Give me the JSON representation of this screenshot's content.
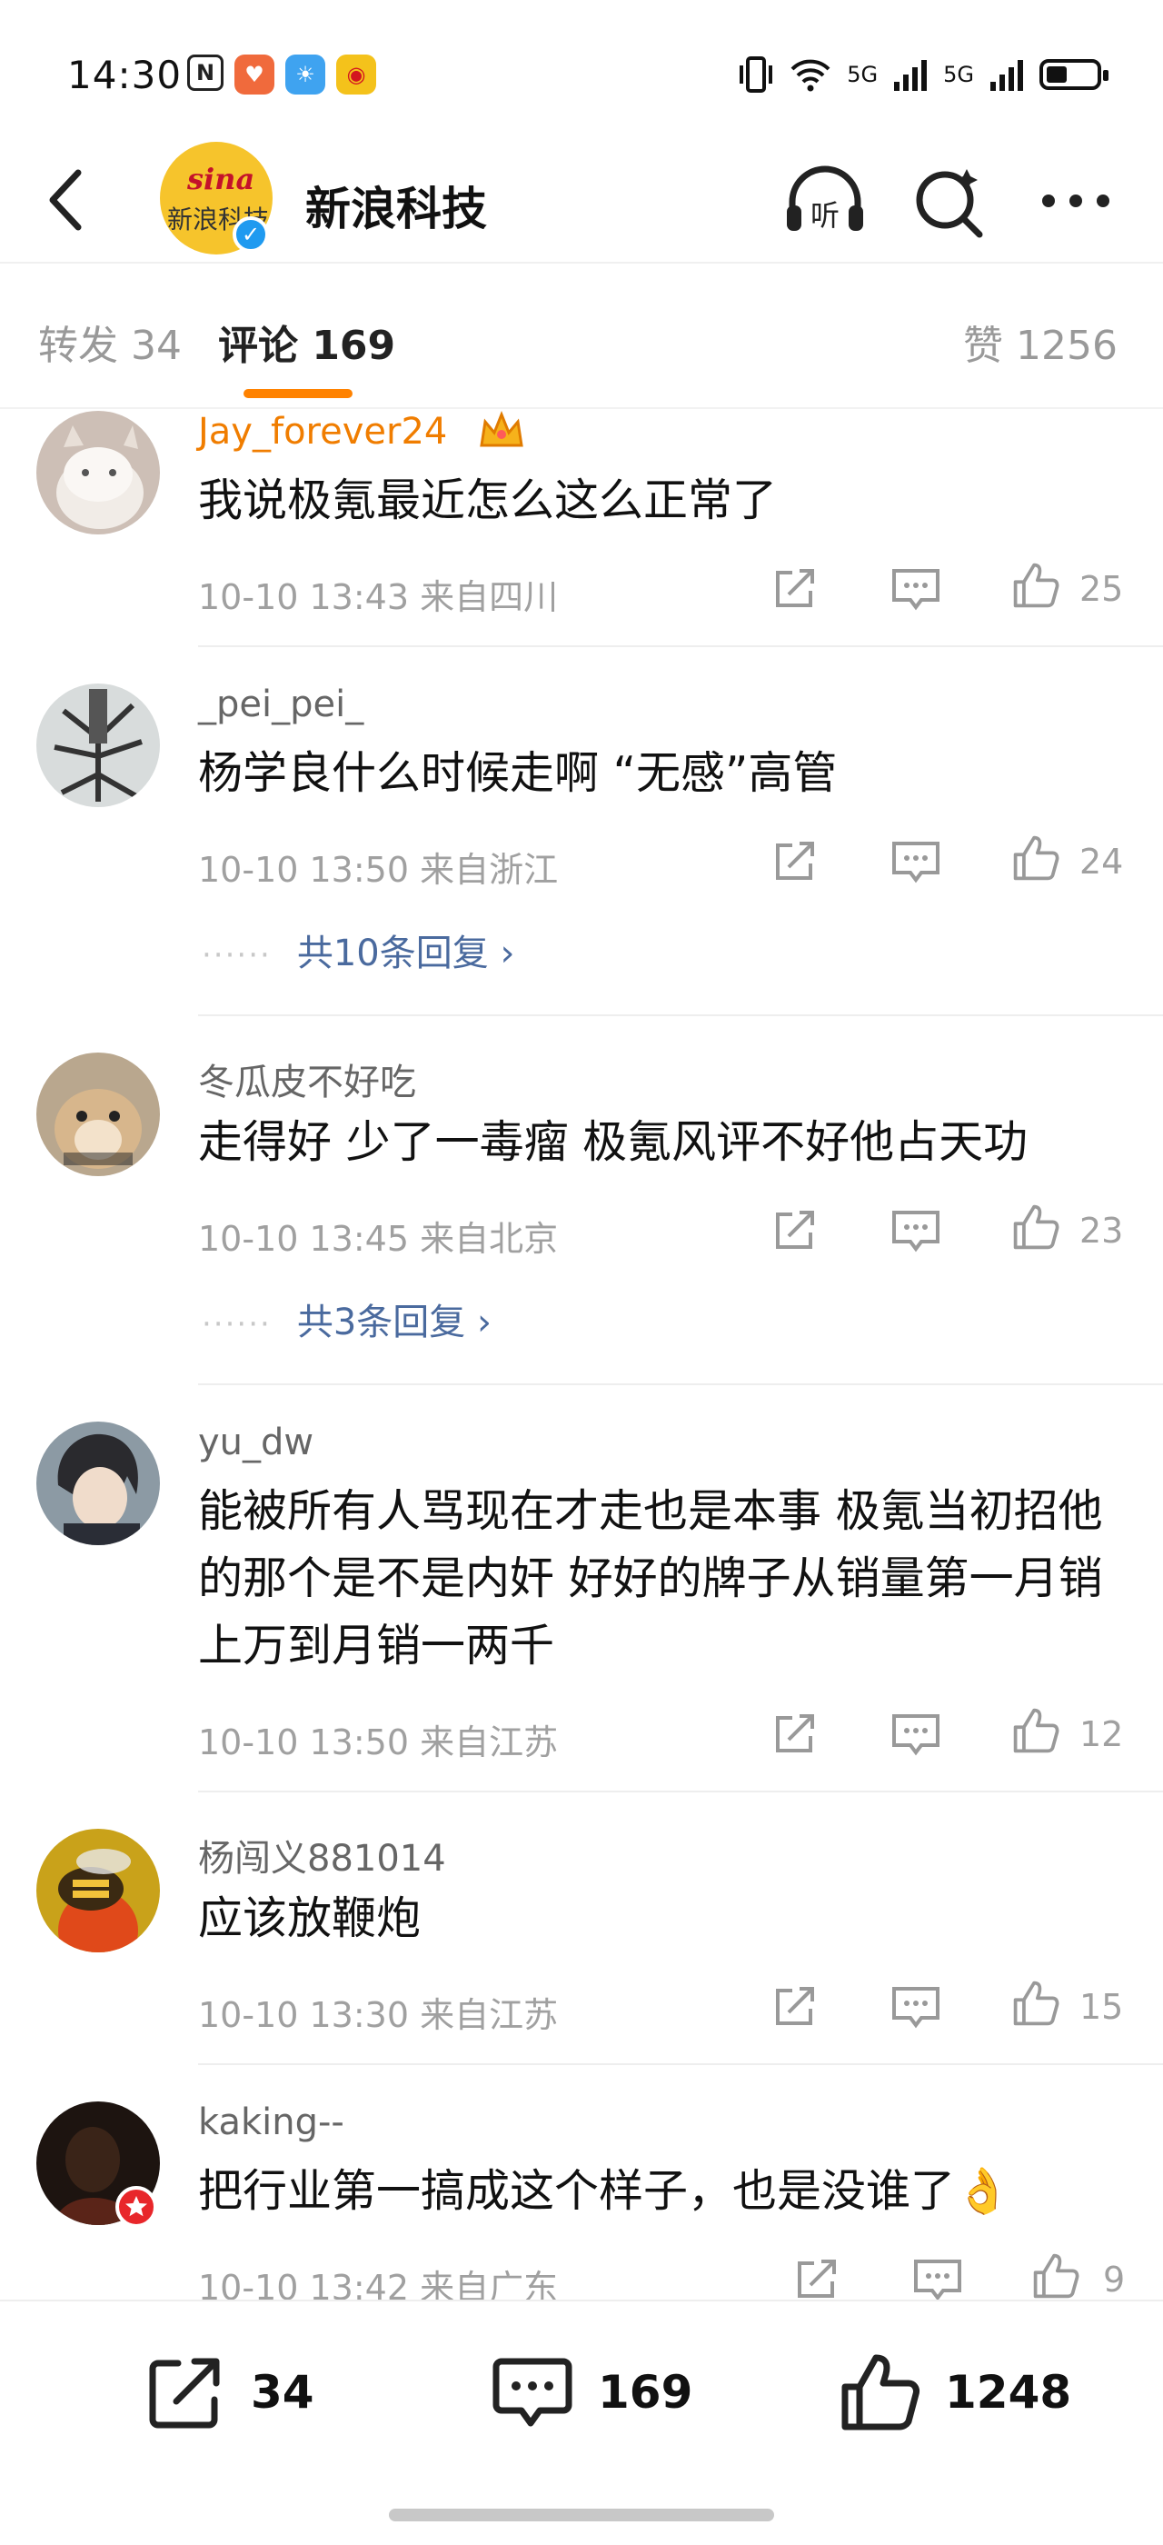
{
  "status_bar": {
    "time": "14:30",
    "network_labels": [
      "5G",
      "5G"
    ]
  },
  "header": {
    "account_name": "新浪科技",
    "avatar_text_top": "sina",
    "avatar_text_bottom": "新浪科技",
    "verified_mark": "✓",
    "listen_label": "听"
  },
  "tabs": {
    "repost": "转发 34",
    "comments": "评论 169",
    "likes": "赞 1256"
  },
  "comments": [
    {
      "user": "Jay_forever24",
      "vip": true,
      "text": "我说极氪最近怎么这么正常了",
      "meta": "10-10 13:43  来自四川",
      "likes": "25",
      "replies": ""
    },
    {
      "user": "_pei_pei_",
      "vip": false,
      "text": "杨学良什么时候走啊 “无感”高管",
      "meta": "10-10 13:50  来自浙江",
      "likes": "24",
      "replies": "共10条回复"
    },
    {
      "user": "冬瓜皮不好吃",
      "vip": false,
      "text": "走得好 少了一毒瘤 极氪风评不好他占天功",
      "meta": "10-10 13:45  来自北京",
      "likes": "23",
      "replies": "共3条回复"
    },
    {
      "user": "yu_dw",
      "vip": false,
      "text": "能被所有人骂现在才走也是本事 极氪当初招他的那个是不是内奸 好好的牌子从销量第一月销上万到月销一两千",
      "meta": "10-10 13:50  来自江苏",
      "likes": "12",
      "replies": ""
    },
    {
      "user": "杨闯义881014",
      "vip": false,
      "text": "应该放鞭炮",
      "meta": "10-10 13:30  来自江苏",
      "likes": "15",
      "replies": ""
    },
    {
      "user": "kaking--",
      "vip": false,
      "text": "把行业第一搞成这个样子，也是没谁了👌",
      "meta": "10-10 13:42  来自广东",
      "likes": "9",
      "replies": ""
    }
  ],
  "reply_chevron": "›",
  "bottom_bar": {
    "reposts": "34",
    "comments": "169",
    "likes": "1248"
  },
  "colors": {
    "accent": "#ff8200",
    "vip_name": "#f07d00",
    "reply_link": "#4a6a9e",
    "verified": "#1f9af0"
  }
}
